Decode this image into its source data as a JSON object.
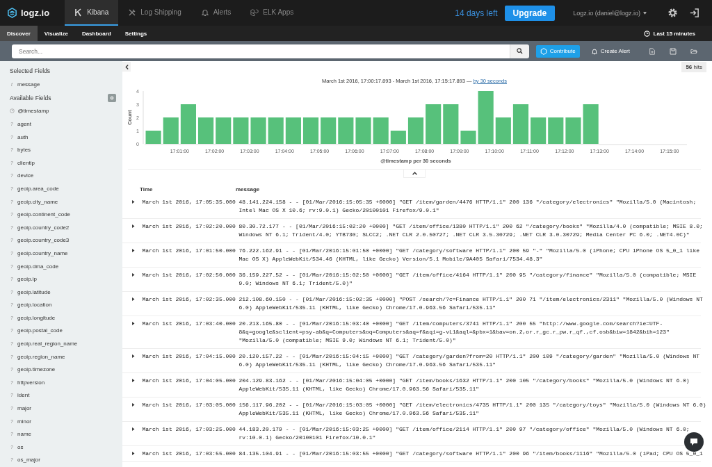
{
  "topbar": {
    "logo": "logz.io",
    "tabs": [
      {
        "label": "Kibana",
        "selected": true
      },
      {
        "label": "Log Shipping",
        "selected": false
      },
      {
        "label": "Alerts",
        "selected": false
      },
      {
        "label": "ELK Apps",
        "selected": false
      }
    ],
    "trial": "14 days left",
    "upgrade": "Upgrade",
    "user": "Logz.io (daniel@logz.io)"
  },
  "subnav": {
    "tabs": [
      {
        "label": "Discover",
        "selected": true
      },
      {
        "label": "Visualize",
        "selected": false
      },
      {
        "label": "Dashboard",
        "selected": false
      },
      {
        "label": "Settings",
        "selected": false
      }
    ],
    "time": "Last 15 minutes"
  },
  "searchbar": {
    "placeholder": "Search...",
    "contribute": "Contribute",
    "create_alert": "Create Alert"
  },
  "sidebar": {
    "selected_title": "Selected Fields",
    "selected": [
      {
        "kind": "glyph",
        "glyph": "t",
        "name": "message"
      }
    ],
    "available_title": "Available Fields",
    "available": [
      {
        "kind": "date",
        "name": "@timestamp"
      },
      {
        "kind": "glyph",
        "glyph": "?",
        "name": "agent"
      },
      {
        "kind": "glyph",
        "glyph": "?",
        "name": "auth"
      },
      {
        "kind": "glyph",
        "glyph": "?",
        "name": "bytes"
      },
      {
        "kind": "glyph",
        "glyph": "?",
        "name": "clientip"
      },
      {
        "kind": "glyph",
        "glyph": "?",
        "name": "device"
      },
      {
        "kind": "glyph",
        "glyph": "?",
        "name": "geoip.area_code"
      },
      {
        "kind": "glyph",
        "glyph": "?",
        "name": "geoip.city_name"
      },
      {
        "kind": "glyph",
        "glyph": "?",
        "name": "geoip.continent_code"
      },
      {
        "kind": "glyph",
        "glyph": "?",
        "name": "geoip.country_code2"
      },
      {
        "kind": "glyph",
        "glyph": "?",
        "name": "geoip.country_code3"
      },
      {
        "kind": "glyph",
        "glyph": "?",
        "name": "geoip.country_name"
      },
      {
        "kind": "glyph",
        "glyph": "?",
        "name": "geoip.dma_code"
      },
      {
        "kind": "glyph",
        "glyph": "?",
        "name": "geoip.ip"
      },
      {
        "kind": "glyph",
        "glyph": "?",
        "name": "geoip.latitude"
      },
      {
        "kind": "glyph",
        "glyph": "?",
        "name": "geoip.location"
      },
      {
        "kind": "glyph",
        "glyph": "?",
        "name": "geoip.longitude"
      },
      {
        "kind": "glyph",
        "glyph": "?",
        "name": "geoip.postal_code"
      },
      {
        "kind": "glyph",
        "glyph": "?",
        "name": "geoip.real_region_name"
      },
      {
        "kind": "glyph",
        "glyph": "?",
        "name": "geoip.region_name"
      },
      {
        "kind": "glyph",
        "glyph": "?",
        "name": "geoip.timezone"
      },
      {
        "kind": "glyph",
        "glyph": "?",
        "name": "httpversion"
      },
      {
        "kind": "glyph",
        "glyph": "?",
        "name": "ident"
      },
      {
        "kind": "glyph",
        "glyph": "?",
        "name": "major"
      },
      {
        "kind": "glyph",
        "glyph": "?",
        "name": "minor"
      },
      {
        "kind": "glyph",
        "glyph": "?",
        "name": "name"
      },
      {
        "kind": "glyph",
        "glyph": "?",
        "name": "os"
      },
      {
        "kind": "glyph",
        "glyph": "?",
        "name": "os_major"
      }
    ]
  },
  "main": {
    "hits": "**56** hits",
    "range": "March 1st 2016, 17:00:17.893 - March 1st 2016, 17:15:17.893 —",
    "interval_link": "by 30 seconds",
    "chart_data": {
      "type": "bar",
      "xlabel": "@timestamp per 30 seconds",
      "ylabel": "Count",
      "categories": [
        null,
        null,
        "17:01:00",
        null,
        "17:02:00",
        null,
        "17:03:00",
        null,
        "17:04:00",
        null,
        "17:05:00",
        null,
        "17:06:00",
        null,
        "17:07:00",
        null,
        "17:08:00",
        null,
        "17:09:00",
        null,
        "17:10:00",
        null,
        "17:11:00",
        null,
        "17:12:00",
        null,
        "17:13:00",
        null,
        "17:14:00",
        null,
        "17:15:00"
      ],
      "series": [
        {
          "color": "#57c17b",
          "values": [
            1,
            2,
            3,
            2,
            2,
            2,
            2,
            2,
            2,
            2,
            2,
            2,
            2,
            2,
            1,
            2,
            3,
            3,
            1,
            4,
            2,
            3,
            2,
            2,
            2,
            3,
            null,
            null,
            null,
            null,
            null
          ]
        }
      ],
      "ylim": [
        0,
        4
      ],
      "yticks": [
        0,
        1,
        2,
        3,
        4
      ]
    },
    "columns": [
      "Time",
      "message"
    ],
    "rows": [
      {
        "time": "March 1st 2016, 17:05:35.000",
        "message": [
          "48.141.224.158 - - [01/Mar/2016:15:05:35 +0000] \"GET /item/garden/4476 HTTP/1.1\" 200 136 \"/category/electronics\" \"Mozilla/5.0 (Macintosh;",
          "Intel Mac OS X 10.6; rv:9.0.1) Gecko/20100101 Firefox/9.0.1\""
        ]
      },
      {
        "time": "March 1st 2016, 17:02:20.000",
        "message": [
          "80.30.72.177 - - [01/Mar/2016:15:02:20 +0000] \"GET /item/office/1380 HTTP/1.1\" 200 62 \"/category/books\" \"Mozilla/4.0 (compatible; MSIE 8.0;",
          "Windows NT 6.1; Trident/4.0; YTB730; SLCC2; .NET CLR 2.0.50727; .NET CLR 3.5.30729; .NET CLR 3.0.30729; Media Center PC 6.0; .NET4.0C)\""
        ]
      },
      {
        "time": "March 1st 2016, 17:01:50.000",
        "message": [
          "76.222.162.91 - - [01/Mar/2016:15:01:50 +0000] \"GET /category/software HTTP/1.1\" 200 59 \"-\" \"Mozilla/5.0 (iPhone; CPU iPhone OS 5_0_1 like",
          "Mac OS X) AppleWebKit/534.46 (KHTML, like Gecko) Version/5.1 Mobile/9A405 Safari/7534.48.3\""
        ]
      },
      {
        "time": "March 1st 2016, 17:02:50.000",
        "message": [
          "36.159.227.52 - - [01/Mar/2016:15:02:50 +0000] \"GET /item/office/4164 HTTP/1.1\" 200 95 \"/category/finance\" \"Mozilla/5.0 (compatible; MSIE",
          "9.0; Windows NT 6.1; Trident/5.0)\""
        ]
      },
      {
        "time": "March 1st 2016, 17:02:35.000",
        "message": [
          "212.108.60.150 - - [01/Mar/2016:15:02:35 +0000] \"POST /search/?c=Finance HTTP/1.1\" 200 71 \"/item/electronics/2311\" \"Mozilla/5.0 (Windows NT",
          "6.0) AppleWebKit/535.11 (KHTML, like Gecko) Chrome/17.0.963.56 Safari/535.11\""
        ]
      },
      {
        "time": "March 1st 2016, 17:03:40.000",
        "message": [
          "20.213.165.80 - - [01/Mar/2016:15:03:40 +0000] \"GET /item/computers/3741 HTTP/1.1\" 200 55 \"http://www.google.com/search?ie=UTF-",
          "8&q=google&sclient=psy-ab&q=Computers&oq=Computers&aq=f&aqi=g-vL1&aql=&pbx=1&bav=on.2,or.r_gc.r_pw.r_qf.,cf.osb&biw=1842&bih=123\"",
          "\"Mozilla/5.0 (compatible; MSIE 9.0; Windows NT 6.1; Trident/5.0)\""
        ]
      },
      {
        "time": "March 1st 2016, 17:04:15.000",
        "message": [
          "20.120.157.22 - - [01/Mar/2016:15:04:15 +0000] \"GET /category/garden?from=20 HTTP/1.1\" 200 109 \"/category/garden\" \"Mozilla/5.0 (Windows NT",
          "6.0) AppleWebKit/535.11 (KHTML, like Gecko) Chrome/17.0.963.56 Safari/535.11\""
        ]
      },
      {
        "time": "March 1st 2016, 17:04:05.000",
        "message": [
          "204.129.83.162 - - [01/Mar/2016:15:04:05 +0000] \"GET /item/books/1632 HTTP/1.1\" 200 105 \"/category/books\" \"Mozilla/5.0 (Windows NT 6.0)",
          "AppleWebKit/535.11 (KHTML, like Gecko) Chrome/17.0.963.56 Safari/535.11\""
        ]
      },
      {
        "time": "March 1st 2016, 17:03:05.000",
        "message": [
          "156.117.96.202 - - [01/Mar/2016:15:03:05 +0000] \"GET /item/electronics/4735 HTTP/1.1\" 200 135 \"/category/toys\" \"Mozilla/5.0 (Windows NT 6.0)",
          "AppleWebKit/535.11 (KHTML, like Gecko) Chrome/17.0.963.56 Safari/535.11\""
        ]
      },
      {
        "time": "March 1st 2016, 17:03:25.000",
        "message": [
          "44.183.20.179 - - [01/Mar/2016:15:03:25 +0000] \"GET /item/office/2114 HTTP/1.1\" 200 97 \"/category/office\" \"Mozilla/5.0 (Windows NT 6.0;",
          "rv:10.0.1) Gecko/20100101 Firefox/10.0.1\""
        ]
      },
      {
        "time": "March 1st 2016, 17:03:55.000",
        "message": [
          "84.135.104.91 - - [01/Mar/2016:15:03:55 +0000] \"GET /category/software HTTP/1.1\" 200 96 \"/item/books/1116\" \"Mozilla/5.0 (iPad; CPU OS 5_0_1"
        ]
      }
    ]
  }
}
